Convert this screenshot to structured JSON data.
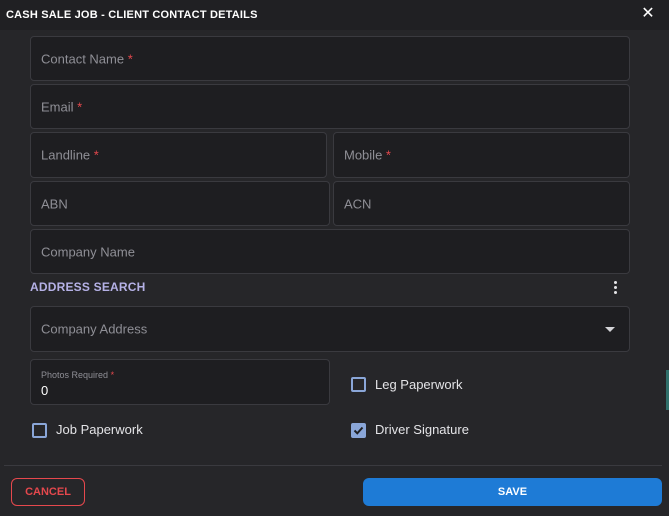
{
  "dialog": {
    "title": "CASH SALE JOB - CLIENT CONTACT DETAILS",
    "close_glyph": "✕"
  },
  "fields": {
    "contact_name": {
      "label": "Contact Name",
      "required": "*"
    },
    "email": {
      "label": "Email",
      "required": "*"
    },
    "landline": {
      "label": "Landline",
      "required": "*"
    },
    "mobile": {
      "label": "Mobile",
      "required": "*"
    },
    "abn": {
      "label": "ABN"
    },
    "acn": {
      "label": "ACN"
    },
    "company_name": {
      "label": "Company Name"
    }
  },
  "address": {
    "section_label": "ADDRESS SEARCH",
    "company_address_label": "Company Address"
  },
  "photos": {
    "label": "Photos Required",
    "required": "*",
    "value": "0"
  },
  "checkboxes": {
    "leg_paperwork": {
      "label": "Leg Paperwork",
      "checked": false
    },
    "job_paperwork": {
      "label": "Job Paperwork",
      "checked": false
    },
    "driver_signature": {
      "label": "Driver Signature",
      "checked": true
    }
  },
  "actions": {
    "cancel_label": "CANCEL",
    "save_label": "SAVE"
  },
  "colors": {
    "accent": "#1e7bd6",
    "danger": "#e5484d",
    "section": "#b5b1e6",
    "checkbox": "#8aa6d8"
  }
}
